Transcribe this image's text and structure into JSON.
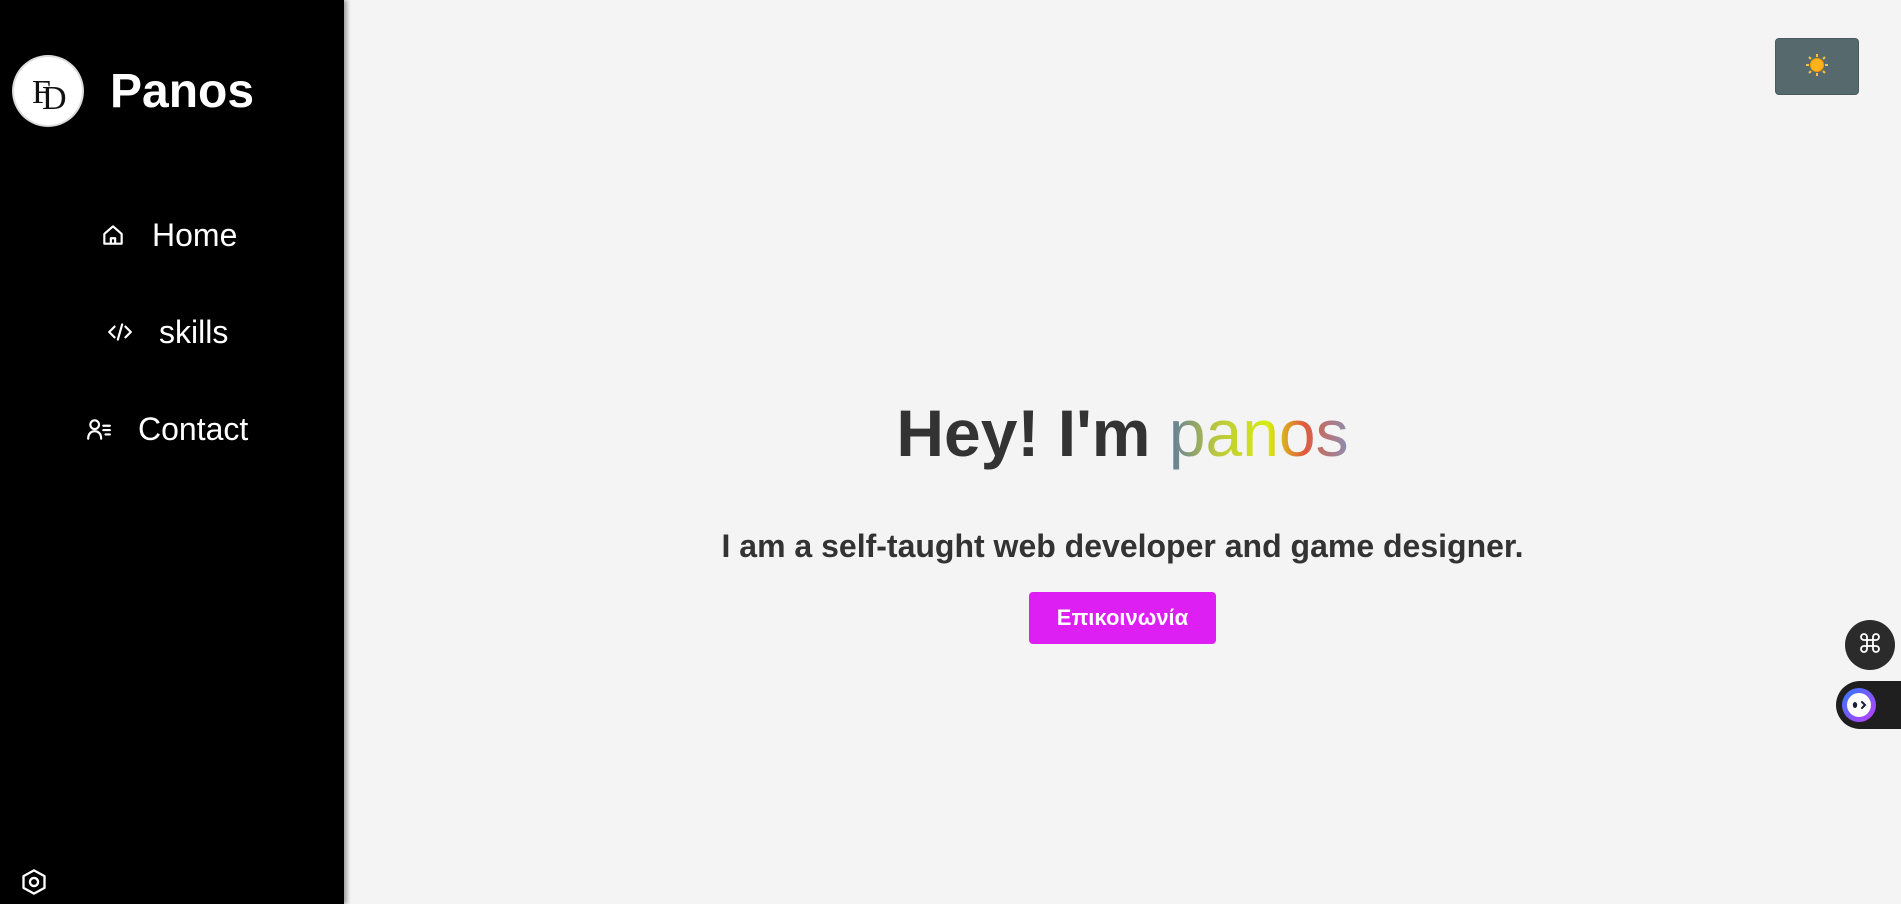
{
  "sidebar": {
    "brand": "Panos",
    "logo_icon": "fd-monogram-logo",
    "items": [
      {
        "label": "Home",
        "icon": "home-icon"
      },
      {
        "label": "skills",
        "icon": "code-icon"
      },
      {
        "label": "Contact",
        "icon": "contact-list-icon"
      }
    ],
    "settings_icon": "hexagon-settings-icon"
  },
  "header": {
    "theme_toggle_icon": "sun-icon"
  },
  "hero": {
    "greeting": "Hey! I'm",
    "name": "panos",
    "subtitle": "I am a self-taught web developer and game designer.",
    "cta_label": "Επικοινωνία"
  },
  "floating": {
    "command_icon": "command-icon",
    "assistant_icon": "bot-face-icon"
  },
  "colors": {
    "sidebar_bg": "#000000",
    "page_bg": "#f4f4f4",
    "cta_bg": "#dd1ff4",
    "toggle_bg": "#566a6e",
    "text_dark": "#333333"
  }
}
